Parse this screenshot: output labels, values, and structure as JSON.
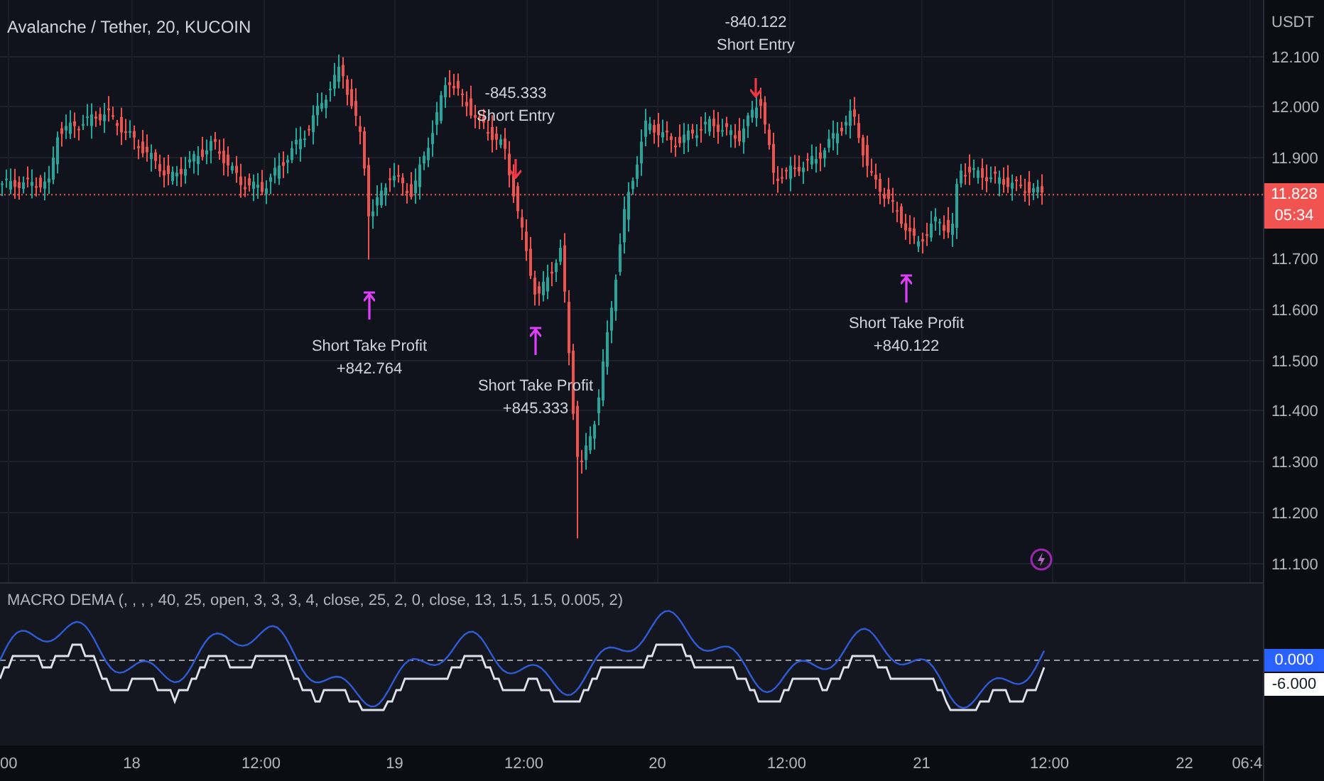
{
  "header": {
    "title": "Avalanche / Tether, 20, KUCOIN"
  },
  "markers": [
    {
      "kind": "take_profit",
      "label": "Short Take Profit",
      "value": "+842.764"
    },
    {
      "kind": "entry",
      "value": "-845.333",
      "label": "Short Entry"
    },
    {
      "kind": "take_profit",
      "label": "Short Take Profit",
      "value": "+845.333"
    },
    {
      "kind": "entry",
      "value": "-840.122",
      "label": "Short Entry"
    },
    {
      "kind": "take_profit",
      "label": "Short Take Profit",
      "value": "+840.122"
    }
  ],
  "indicator": {
    "title": "MACRO DEMA (, , , , 40, 25, open, 3, 3, 3, 4, close, 25, 2, 0, close, 13, 1.5, 1.5, 0.005, 2)",
    "value_labels": [
      {
        "kind": "primary",
        "text": "0.000"
      },
      {
        "kind": "secondary",
        "text": "-6.000"
      }
    ]
  },
  "price_axis": {
    "currency": "USDT",
    "ticks": [
      "12.100",
      "12.000",
      "11.900",
      "11.700",
      "11.600",
      "11.500",
      "11.400",
      "11.300",
      "11.200",
      "11.100"
    ],
    "last_price": "11.828",
    "countdown": "05:34"
  },
  "time_axis": {
    "labels": [
      "00",
      "18",
      "12:00",
      "19",
      "12:00",
      "20",
      "12:00",
      "21",
      "12:00",
      "22",
      "06:4"
    ]
  }
}
